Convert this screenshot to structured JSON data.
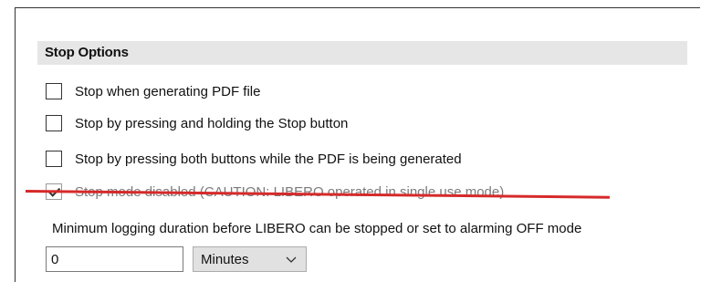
{
  "section": {
    "title": "Stop Options"
  },
  "options": [
    {
      "label": "Stop when generating PDF file",
      "checked": false,
      "disabled": false
    },
    {
      "label": "Stop by pressing and holding the Stop button",
      "checked": false,
      "disabled": false
    },
    {
      "label": "Stop by pressing both buttons while the PDF is being generated",
      "checked": false,
      "disabled": false
    },
    {
      "label": "Stop mode disabled (CAUTION: LIBERO operated in single use mode)",
      "checked": true,
      "disabled": true
    }
  ],
  "strike_color": "#d62a2a",
  "min_duration": {
    "label": "Minimum logging duration before LIBERO can be stopped or set to alarming OFF mode",
    "value": "0",
    "unit": "Minutes"
  }
}
